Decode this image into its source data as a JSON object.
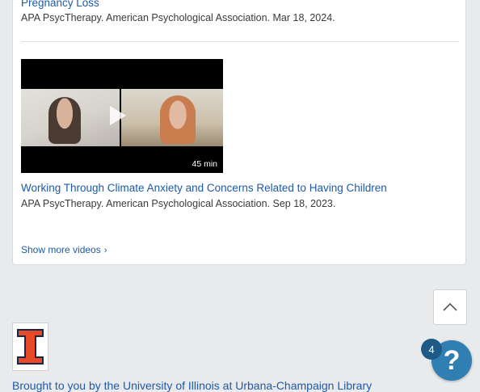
{
  "videos": [
    {
      "title": "Pregnancy Loss",
      "meta": "APA PsycTherapy. American Psychological Association. Mar 18, 2024."
    },
    {
      "title": "Working Through Climate Anxiety and Concerns Related to Having Children",
      "meta": "APA PsycTherapy. American Psychological Association. Sep 18, 2023.",
      "duration": "45 min"
    }
  ],
  "show_more_label": "Show more videos",
  "footer": {
    "brought_by": "Brought to you by the University of Illinois at Urbana-Champaign Library",
    "logo_color": "#e84a27"
  },
  "help": {
    "badge_count": "4",
    "symbol": "?"
  },
  "colors": {
    "link": "#1e5aa8",
    "help_button": "#2f7fb3",
    "page_bg": "#e9eaec"
  }
}
